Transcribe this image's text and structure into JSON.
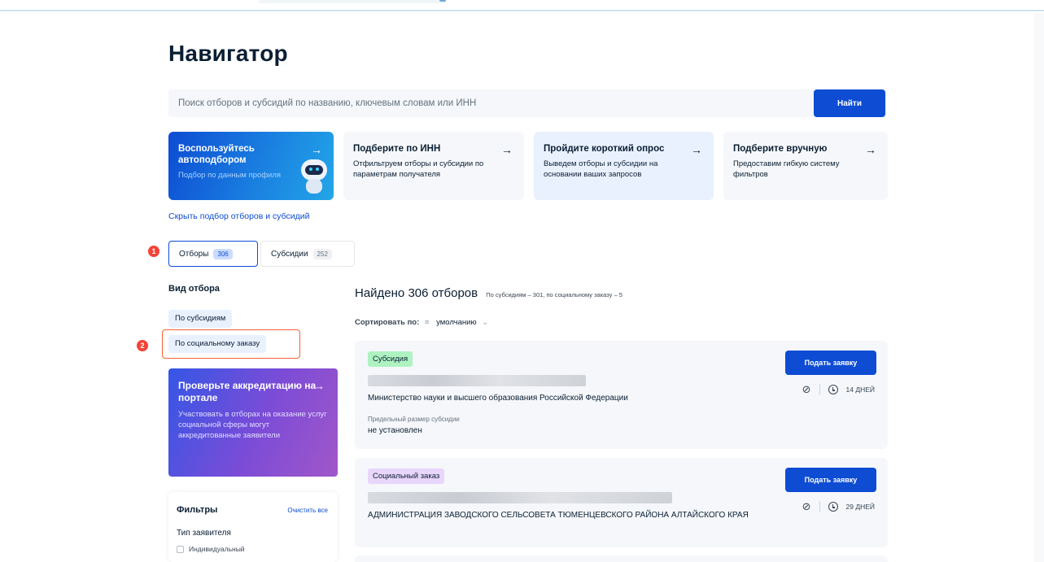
{
  "page": {
    "title": "Навигатор"
  },
  "search": {
    "placeholder": "Поиск отборов и субсидий по названию, ключевым словам или ИНН",
    "button_label": "Найти"
  },
  "cards": [
    {
      "title": "Воспользуйтесь автоподбором",
      "desc": "Подбор по данным профиля",
      "arrow": "→"
    },
    {
      "title": "Подберите по ИНН",
      "desc": "Отфильтруем отборы и субсидии по параметрам получателя",
      "arrow": "→"
    },
    {
      "title": "Пройдите короткий опрос",
      "desc": "Выведем отборы и субсидии на основании ваших запросов",
      "arrow": "→"
    },
    {
      "title": "Подберите вручную",
      "desc": "Предоставим гибкую систему фильтров",
      "arrow": "→"
    }
  ],
  "hide_link": "Скрыть подбор отборов и субсидий",
  "step_markers": [
    "1",
    "2"
  ],
  "tabs": [
    {
      "label": "Отборы",
      "count": "306"
    },
    {
      "label": "Субсидии",
      "count": "252"
    }
  ],
  "sidebar": {
    "title": "Вид отбора",
    "chips": [
      "По субсидиям",
      "По социальному заказу"
    ],
    "accreditation": {
      "title": "Проверьте аккредитацию на портале",
      "desc": "Участвовать в отборах на оказание услуг социальной сферы могут аккредитованные заявители",
      "arrow": "→"
    },
    "filters": {
      "title": "Фильтры",
      "clear_label": "Очистить все",
      "group_label": "Тип заявителя",
      "options": [
        "Индивидуальный"
      ]
    }
  },
  "results": {
    "found": "Найдено 306 отборов",
    "found_sub": "По субсидиям – 301, по социальному заказу – 5",
    "sort_label": "Сортировать по:",
    "sort_value": "умолчанию",
    "items": [
      {
        "tag": "Субсидия",
        "org": "Министерство науки и высшего образования Российской Федерации",
        "limit_label": "Предельный размер субсидии",
        "limit_value": "не установлен",
        "button": "Подать заявку",
        "days": "14 ДНЕЙ"
      },
      {
        "tag": "Социальный заказ",
        "org": "АДМИНИСТРАЦИЯ ЗАВОДСКОГО СЕЛЬСОВЕТА ТЮМЕНЦЕВСКОГО РАЙОНА АЛТАЙСКОГО КРАЯ",
        "button": "Подать заявку",
        "days": "29 ДНЕЙ"
      }
    ]
  },
  "colors": {
    "accent": "#0d4cd3",
    "marker": "#f44336",
    "highlight_frame": "#f5613a"
  }
}
